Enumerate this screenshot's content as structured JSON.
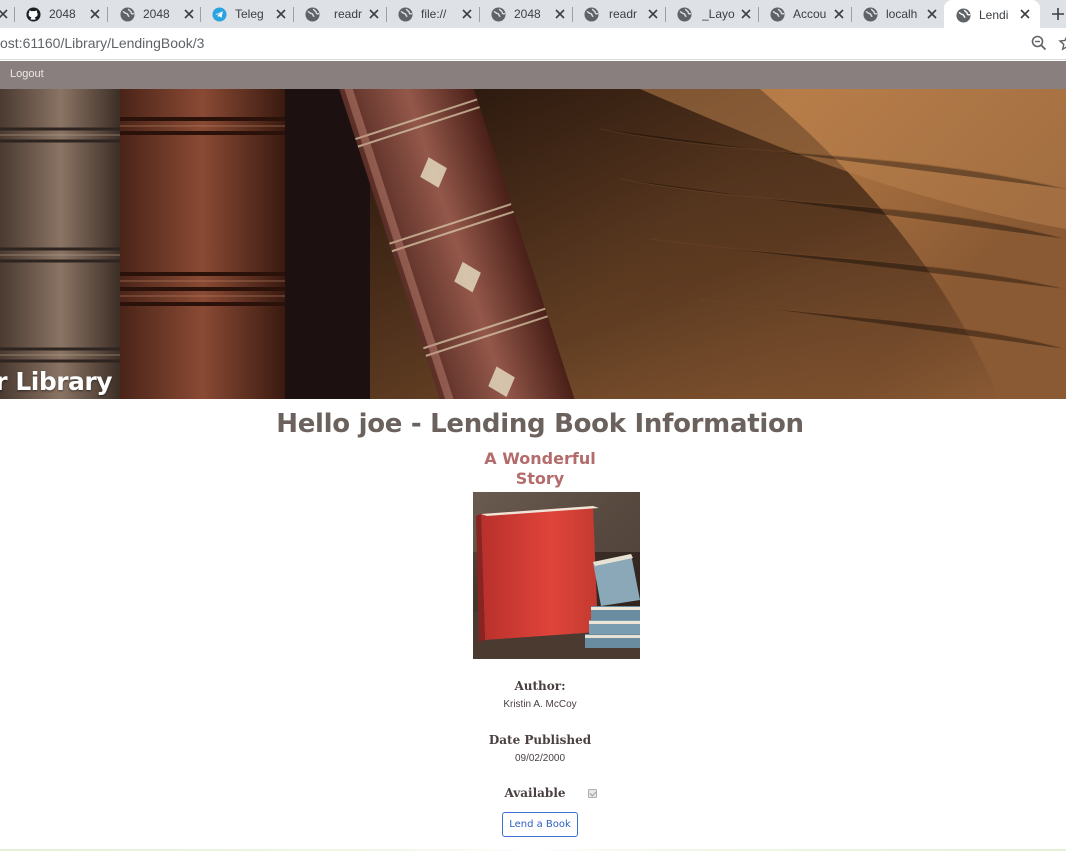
{
  "browser": {
    "tabs": [
      {
        "title": "2048",
        "icon": "github-icon"
      },
      {
        "title": "2048",
        "icon": "globe-icon"
      },
      {
        "title": "Teleg",
        "icon": "telegram-icon"
      },
      {
        "title": "readr",
        "icon": "globe-icon"
      },
      {
        "title": "file://",
        "icon": "globe-icon"
      },
      {
        "title": "2048",
        "icon": "globe-icon"
      },
      {
        "title": "readr",
        "icon": "globe-icon"
      },
      {
        "title": "_Layo",
        "icon": "globe-icon"
      },
      {
        "title": "Accou",
        "icon": "globe-icon"
      },
      {
        "title": "localh",
        "icon": "globe-icon"
      },
      {
        "title": "Lendi",
        "icon": "globe-icon",
        "active": true
      }
    ],
    "url": "ost:61160/Library/LendingBook/3"
  },
  "nav": {
    "logout_label": "Logout"
  },
  "hero": {
    "title": "ur Library"
  },
  "page": {
    "heading": "Hello joe - Lending Book Information",
    "book_title": "A Wonderful Story",
    "author_label": "Author:",
    "author_value": "Kristin A. McCoy",
    "date_label": "Date Published",
    "date_value": "09/02/2000",
    "available_label": "Available",
    "available_checked": true,
    "lend_button": "Lend a Book"
  },
  "colors": {
    "nav_bar": "#8a7f7f",
    "heading": "#6b625e",
    "book_title": "#b36b6b",
    "button_border": "#3b6fd1"
  }
}
